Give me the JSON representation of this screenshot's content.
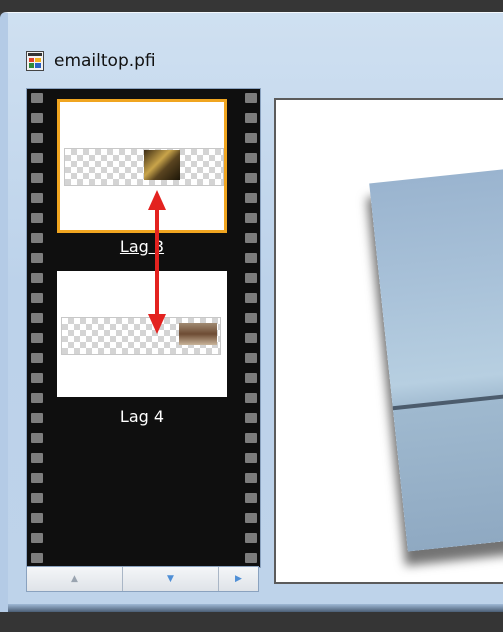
{
  "window": {
    "title": "emailtop.pfi",
    "icon": "document-icon"
  },
  "layers": [
    {
      "label": "Lag 3",
      "selected": true
    },
    {
      "label": "Lag 4",
      "selected": false
    }
  ],
  "scrollbar": {
    "left_button_icon": "arrow-up-icon",
    "middle_button_icon": "arrow-down-icon",
    "right_button_icon": "arrow-right-icon"
  },
  "colors": {
    "selection_border": "#f0a520",
    "arrow": "#e3221f",
    "filmstrip_bg": "#0f0f0f"
  }
}
